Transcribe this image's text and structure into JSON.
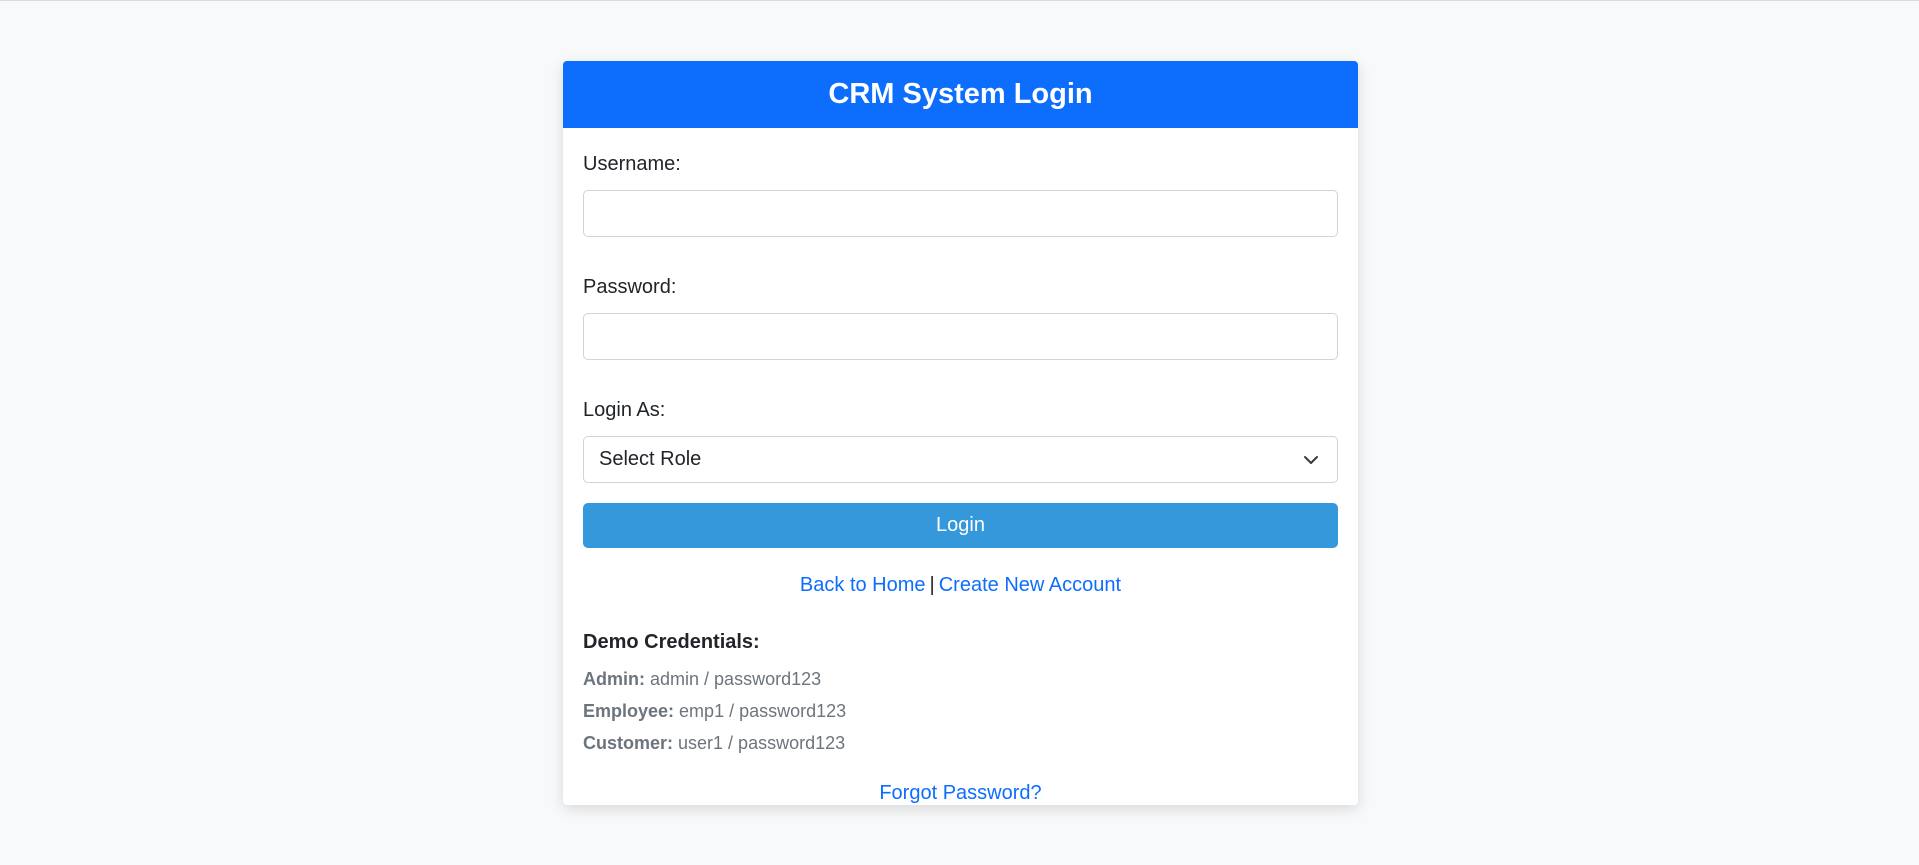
{
  "header": {
    "title": "CRM System Login"
  },
  "form": {
    "username_label": "Username:",
    "username_value": "",
    "password_label": "Password:",
    "password_value": "",
    "role_label": "Login As:",
    "role_selected": "Select Role",
    "login_button": "Login"
  },
  "links": {
    "back_home": "Back to Home",
    "separator": "|",
    "create_account": "Create New Account",
    "forgot_password": "Forgot Password?"
  },
  "demo": {
    "title": "Demo Credentials:",
    "items": [
      {
        "role": "Admin:",
        "creds": "admin / password123"
      },
      {
        "role": "Employee:",
        "creds": "emp1 / password123"
      },
      {
        "role": "Customer:",
        "creds": "user1 / password123"
      }
    ]
  },
  "icons": {
    "select_chevron": "chevron-down-icon"
  },
  "colors": {
    "header_bg": "#0d6efd",
    "login_button_bg": "#3498db",
    "link": "#0d6efd",
    "page_bg": "#f8f9fa"
  }
}
